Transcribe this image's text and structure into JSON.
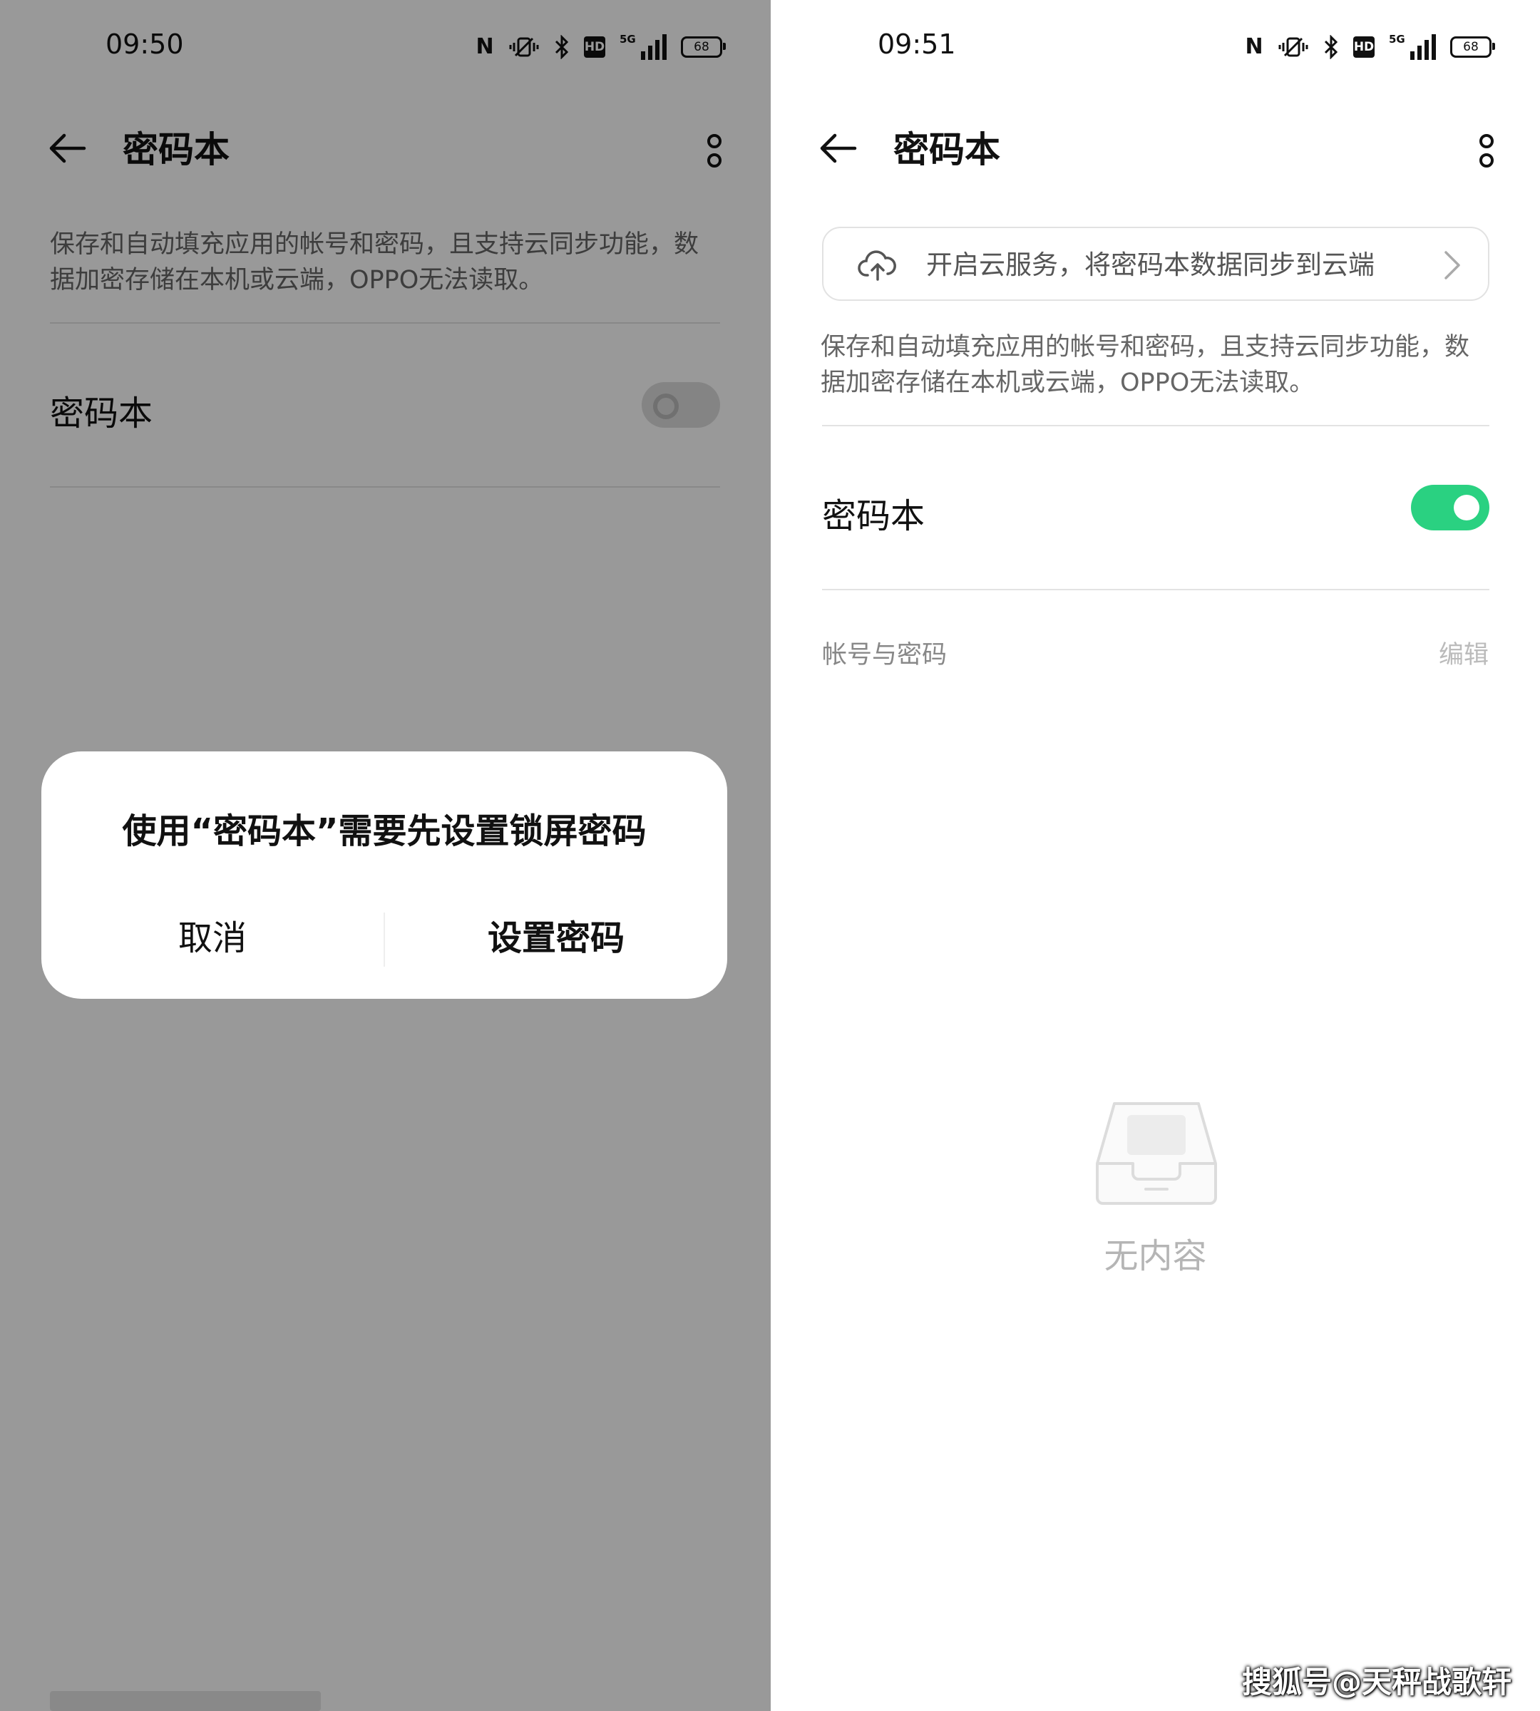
{
  "left_screen": {
    "status_bar": {
      "time": "09:50",
      "network": "5G",
      "hd_label": "HD",
      "battery": "68",
      "icons": [
        "nfc-icon",
        "vibrate-icon",
        "bluetooth-icon",
        "hd-icon",
        "signal-icon",
        "battery-icon"
      ]
    },
    "top_bar": {
      "title": "密码本"
    },
    "description": "保存和自动填充应用的帐号和密码，且支持云同步功能，数据加密存储在本机或云端，OPPO无法读取。",
    "setting_row": {
      "label": "密码本",
      "enabled": false
    },
    "dialog": {
      "message": "使用“密码本”需要先设置锁屏密码",
      "cancel_label": "取消",
      "confirm_label": "设置密码"
    }
  },
  "right_screen": {
    "status_bar": {
      "time": "09:51",
      "network": "5G",
      "hd_label": "HD",
      "battery": "68",
      "icons": [
        "nfc-icon",
        "vibrate-icon",
        "bluetooth-icon",
        "hd-icon",
        "signal-icon",
        "battery-icon"
      ]
    },
    "top_bar": {
      "title": "密码本"
    },
    "cloud_banner": {
      "text": "开启云服务，将密码本数据同步到云端",
      "icon": "cloud-upload-icon"
    },
    "description": "保存和自动填充应用的帐号和密码，且支持云同步功能，数据加密存储在本机或云端，OPPO无法读取。",
    "setting_row": {
      "label": "密码本",
      "enabled": true
    },
    "section": {
      "label": "帐号与密码",
      "edit_label": "编辑"
    },
    "empty_state": {
      "icon": "empty-tray-icon",
      "text": "无内容"
    }
  },
  "watermark": "搜狐号@天秤战歌轩",
  "colors": {
    "accent_green": "#2ad181",
    "overlay": "rgba(0,0,0,0.4)",
    "text_primary": "#111111",
    "text_secondary": "#666666"
  }
}
